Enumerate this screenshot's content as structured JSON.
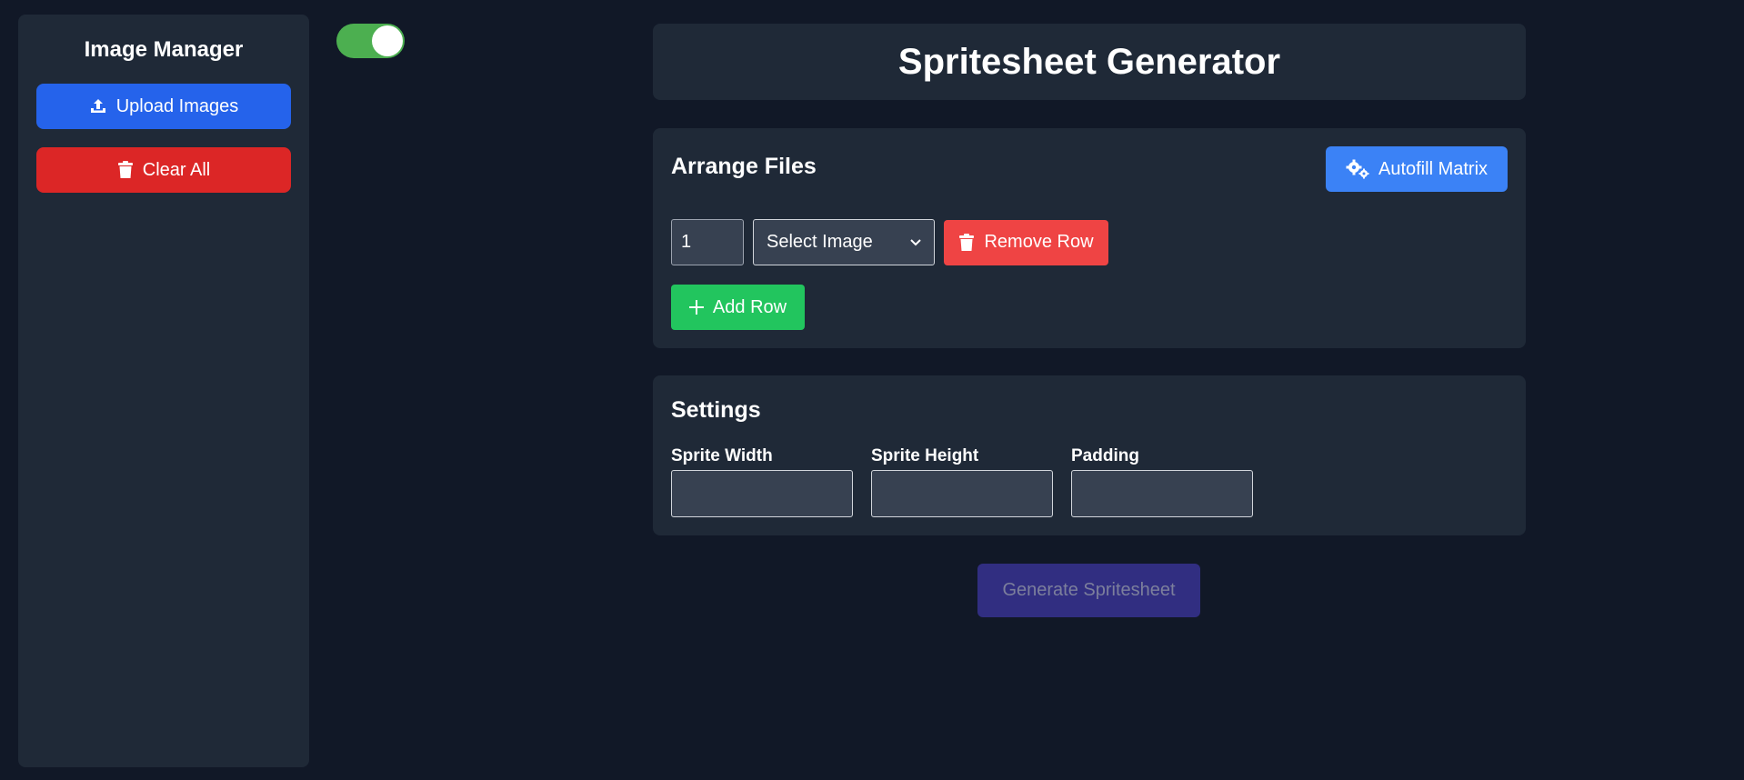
{
  "sidebar": {
    "title": "Image Manager",
    "upload_label": "Upload Images",
    "clear_label": "Clear All"
  },
  "toggle": {
    "state": "on",
    "color": "#4caf50"
  },
  "header": {
    "title": "Spritesheet Generator"
  },
  "arrange": {
    "title": "Arrange Files",
    "autofill_label": "Autofill Matrix",
    "rows": [
      {
        "index": "1",
        "select_value": "Select Image",
        "remove_label": "Remove Row"
      }
    ],
    "add_row_label": "Add Row"
  },
  "settings": {
    "title": "Settings",
    "fields": [
      {
        "label": "Sprite Width",
        "value": ""
      },
      {
        "label": "Sprite Height",
        "value": ""
      },
      {
        "label": "Padding",
        "value": ""
      }
    ]
  },
  "generate_label": "Generate Spritesheet",
  "colors": {
    "background": "#111827",
    "panel": "#1f2937",
    "upload": "#2563eb",
    "clear": "#dc2626",
    "autofill": "#3b82f6",
    "remove": "#ef4444",
    "add": "#22c55e",
    "generate": "#312e81"
  }
}
